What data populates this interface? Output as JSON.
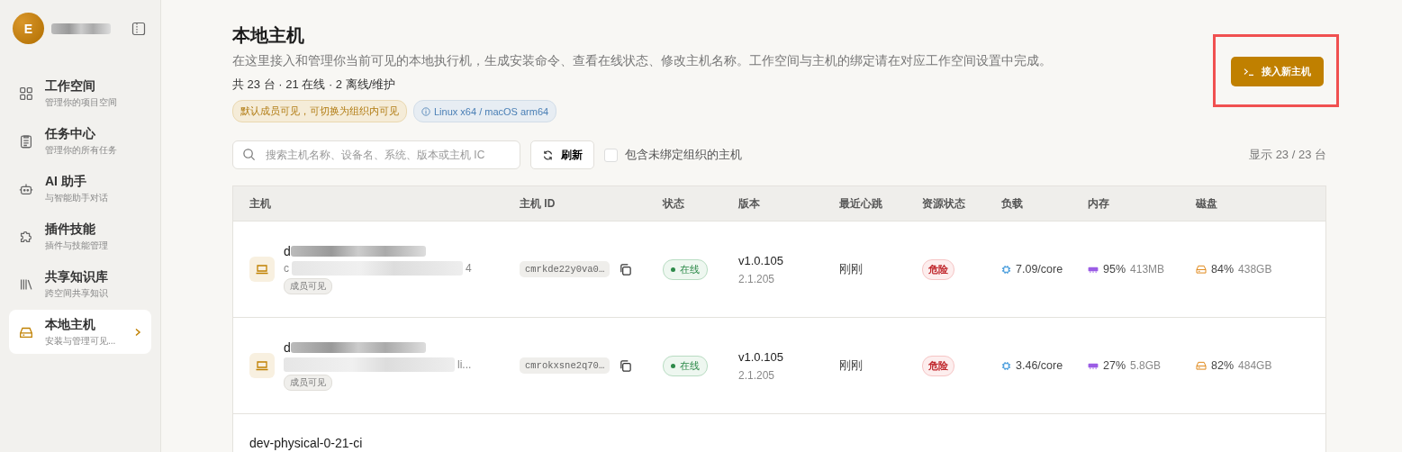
{
  "sidebar": {
    "user": {
      "avatar_letter": "E",
      "name_redacted": true
    },
    "items": [
      {
        "title": "工作空间",
        "subtitle": "管理你的项目空间",
        "selected": false
      },
      {
        "title": "任务中心",
        "subtitle": "管理你的所有任务",
        "selected": false
      },
      {
        "title": "AI 助手",
        "subtitle": "与智能助手对话",
        "selected": false
      },
      {
        "title": "插件技能",
        "subtitle": "插件与技能管理",
        "selected": false
      },
      {
        "title": "共享知识库",
        "subtitle": "跨空间共享知识",
        "selected": false
      },
      {
        "title": "本地主机",
        "subtitle": "安装与管理可见...",
        "selected": true
      }
    ]
  },
  "header": {
    "title": "本地主机",
    "description": "在这里接入和管理你当前可见的本地执行机，生成安装命令、查看在线状态、修改主机名称。工作空间与主机的绑定请在对应工作空间设置中完成。",
    "summary": "共 23 台 · 21 在线 · 2 离线/维护",
    "tags": [
      {
        "kind": "warn",
        "text": "默认成员可见，可切换为组织内可见"
      },
      {
        "kind": "info",
        "text": "Linux x64 / macOS arm64"
      }
    ],
    "button": {
      "label": "接入新主机",
      "highlighted": true
    }
  },
  "toolbar": {
    "search": {
      "placeholder": "搜索主机名称、设备名、系统、版本或主机 IC"
    },
    "refresh": "刷新",
    "include_unbound": {
      "label": "包含未绑定组织的主机",
      "checked": false
    },
    "count": "显示 23 / 23 台"
  },
  "table": {
    "columns": [
      "主机",
      "主机 ID",
      "状态",
      "版本",
      "最近心跳",
      "资源状态",
      "负载",
      "内存",
      "磁盘"
    ],
    "rows": [
      {
        "name": "d",
        "name_redacted": true,
        "subtitle_start": "c",
        "subtitle_end": "4",
        "visibility": "成员可见",
        "host_id": "cmrkde22y0va0…",
        "status": {
          "kind": "online",
          "text": "在线"
        },
        "version": "v1.0.105",
        "version_sub": "2.1.205",
        "heartbeat": "刚刚",
        "resource": {
          "kind": "danger",
          "text": "危险"
        },
        "load": "7.09/core",
        "memory_pct": "95%",
        "memory": "413MB",
        "disk_pct": "84%",
        "disk": "438GB"
      },
      {
        "name": "d",
        "name_redacted": true,
        "subtitle_end": "li...",
        "visibility": "成员可见",
        "host_id": "cmrokxsne2q70…",
        "status": {
          "kind": "online",
          "text": "在线"
        },
        "version": "v1.0.105",
        "version_sub": "2.1.205",
        "heartbeat": "刚刚",
        "resource": {
          "kind": "danger",
          "text": "危险"
        },
        "load": "3.46/core",
        "memory_pct": "27%",
        "memory": "5.8GB",
        "disk_pct": "82%",
        "disk": "484GB"
      },
      {
        "name": "dev-physical-0-21-ci",
        "name_redacted": false
      }
    ]
  }
}
